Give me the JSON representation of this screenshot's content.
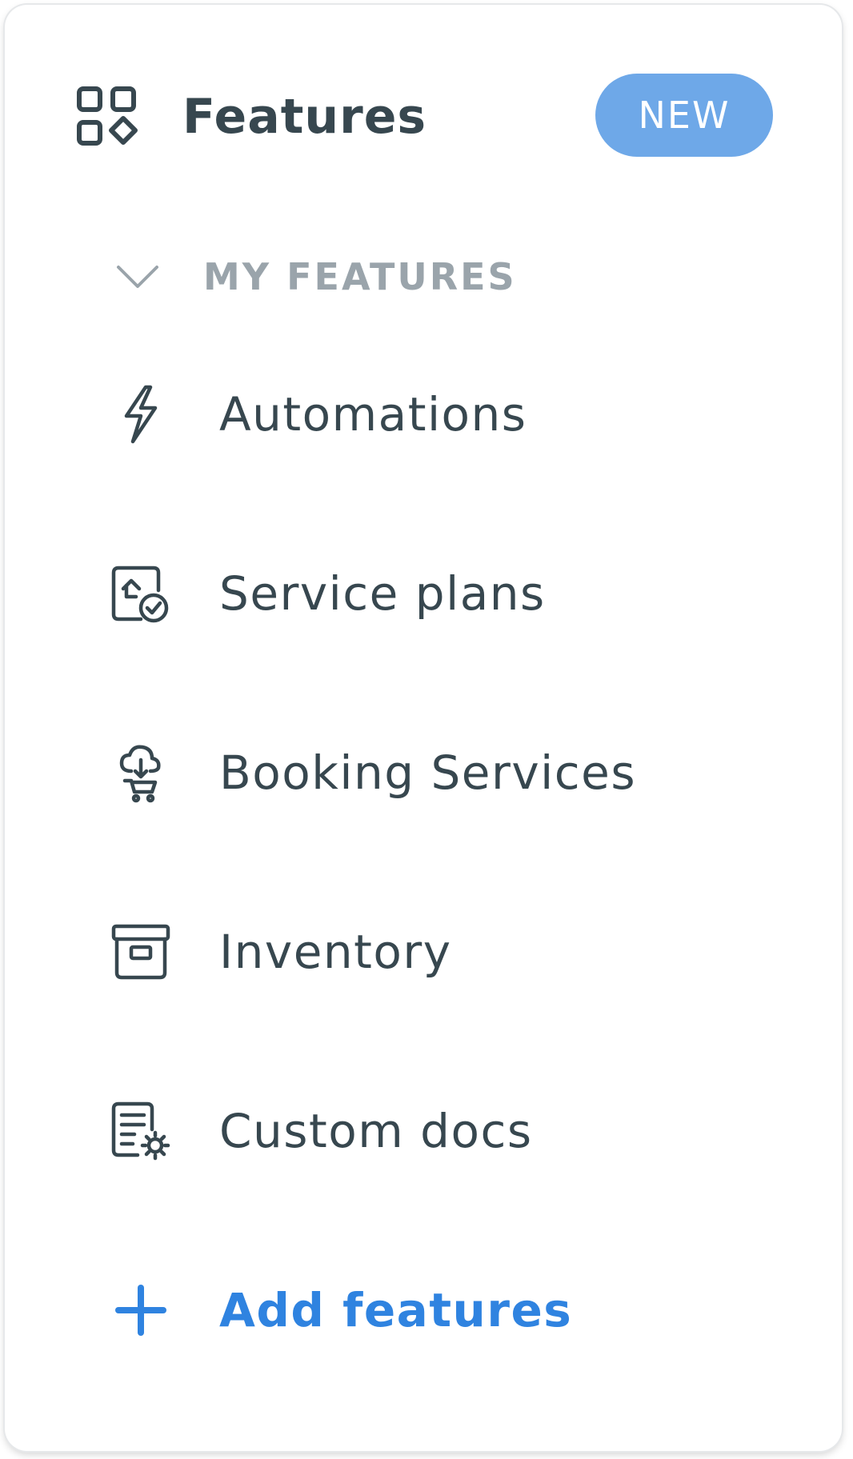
{
  "header": {
    "icon": "features-grid-icon",
    "title": "Features",
    "badge": "NEW"
  },
  "section": {
    "icon": "chevron-down-icon",
    "label": "MY FEATURES"
  },
  "items": [
    {
      "label": "Automations",
      "icon": "lightning-icon"
    },
    {
      "label": "Service plans",
      "icon": "service-plan-icon"
    },
    {
      "label": "Booking Services",
      "icon": "booking-cart-icon"
    },
    {
      "label": "Inventory",
      "icon": "archive-box-icon"
    },
    {
      "label": "Custom docs",
      "icon": "doc-gear-icon"
    }
  ],
  "add": {
    "label": "Add features",
    "icon": "plus-icon"
  },
  "colors": {
    "text": "#37474f",
    "muted": "#9aa4ab",
    "badge": "#6ea8e8",
    "accent": "#2f83e0"
  }
}
